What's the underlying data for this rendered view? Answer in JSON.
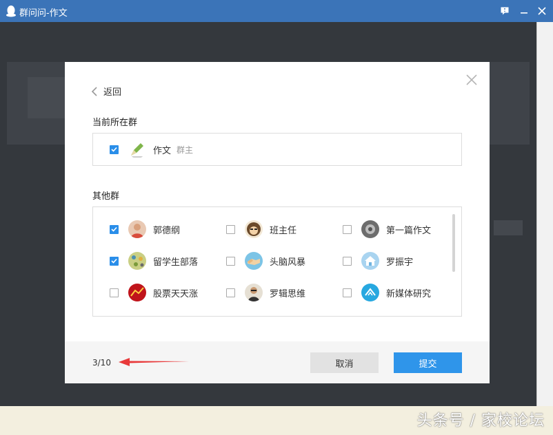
{
  "window": {
    "title": "群问问-作文"
  },
  "dialog": {
    "back_label": "返回",
    "current_section_title": "当前所在群",
    "current_group": {
      "name": "作文",
      "role": "群主",
      "checked": true,
      "avatar_icon": "pen-icon"
    },
    "other_section_title": "其他群",
    "groups": [
      {
        "name": "郭德纲",
        "checked": true,
        "avatar_icon": "person-avatar"
      },
      {
        "name": "班主任",
        "checked": false,
        "avatar_icon": "cartoon-avatar"
      },
      {
        "name": "第一篇作文",
        "checked": false,
        "avatar_icon": "grey-avatar"
      },
      {
        "name": "留学生部落",
        "checked": true,
        "avatar_icon": "pattern-avatar"
      },
      {
        "name": "头脑风暴",
        "checked": false,
        "avatar_icon": "handshake-avatar"
      },
      {
        "name": "罗振宇",
        "checked": false,
        "avatar_icon": "home-avatar"
      },
      {
        "name": "股票天天涨",
        "checked": false,
        "avatar_icon": "red-avatar"
      },
      {
        "name": "罗辑思维",
        "checked": false,
        "avatar_icon": "portrait-avatar"
      },
      {
        "name": "新媒体研究",
        "checked": false,
        "avatar_icon": "blue-logo-avatar"
      }
    ],
    "selection_count": "3/10",
    "cancel_label": "取消",
    "submit_label": "提交"
  },
  "watermark": "头条号 / 家校论坛",
  "colors": {
    "accent": "#2f95ea",
    "titlebar": "#3b74b8",
    "arrow": "#e8393a"
  }
}
